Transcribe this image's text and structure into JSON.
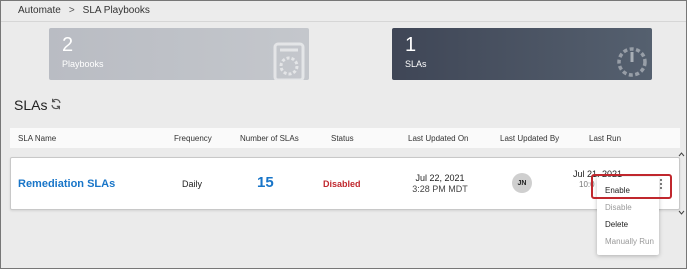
{
  "breadcrumb": {
    "root": "Automate",
    "separator": ">",
    "current": "SLA Playbooks"
  },
  "cards": {
    "playbooks": {
      "count": "2",
      "label": "Playbooks"
    },
    "slas": {
      "count": "1",
      "label": "SLAs"
    }
  },
  "section": {
    "title": "SLAs"
  },
  "table": {
    "headers": {
      "name": "SLA Name",
      "frequency": "Frequency",
      "number": "Number of SLAs",
      "status": "Status",
      "last_updated_on": "Last Updated On",
      "last_updated_by": "Last Updated By",
      "last_run": "Last Run"
    },
    "rows": [
      {
        "name": "Remediation SLAs",
        "frequency": "Daily",
        "number": "15",
        "status": "Disabled",
        "updated_date": "Jul 22, 2021",
        "updated_time": "3:28 PM MDT",
        "updated_by": "JN",
        "last_run_date": "Jul 21, 2021",
        "last_run_time": "10:0"
      }
    ]
  },
  "menu": {
    "enable": "Enable",
    "disable": "Disable",
    "delete": "Delete",
    "manual_run": "Manually Run"
  },
  "colors": {
    "link": "#1875c8",
    "status_disabled": "#c0272d",
    "highlight": "#c0272d"
  }
}
